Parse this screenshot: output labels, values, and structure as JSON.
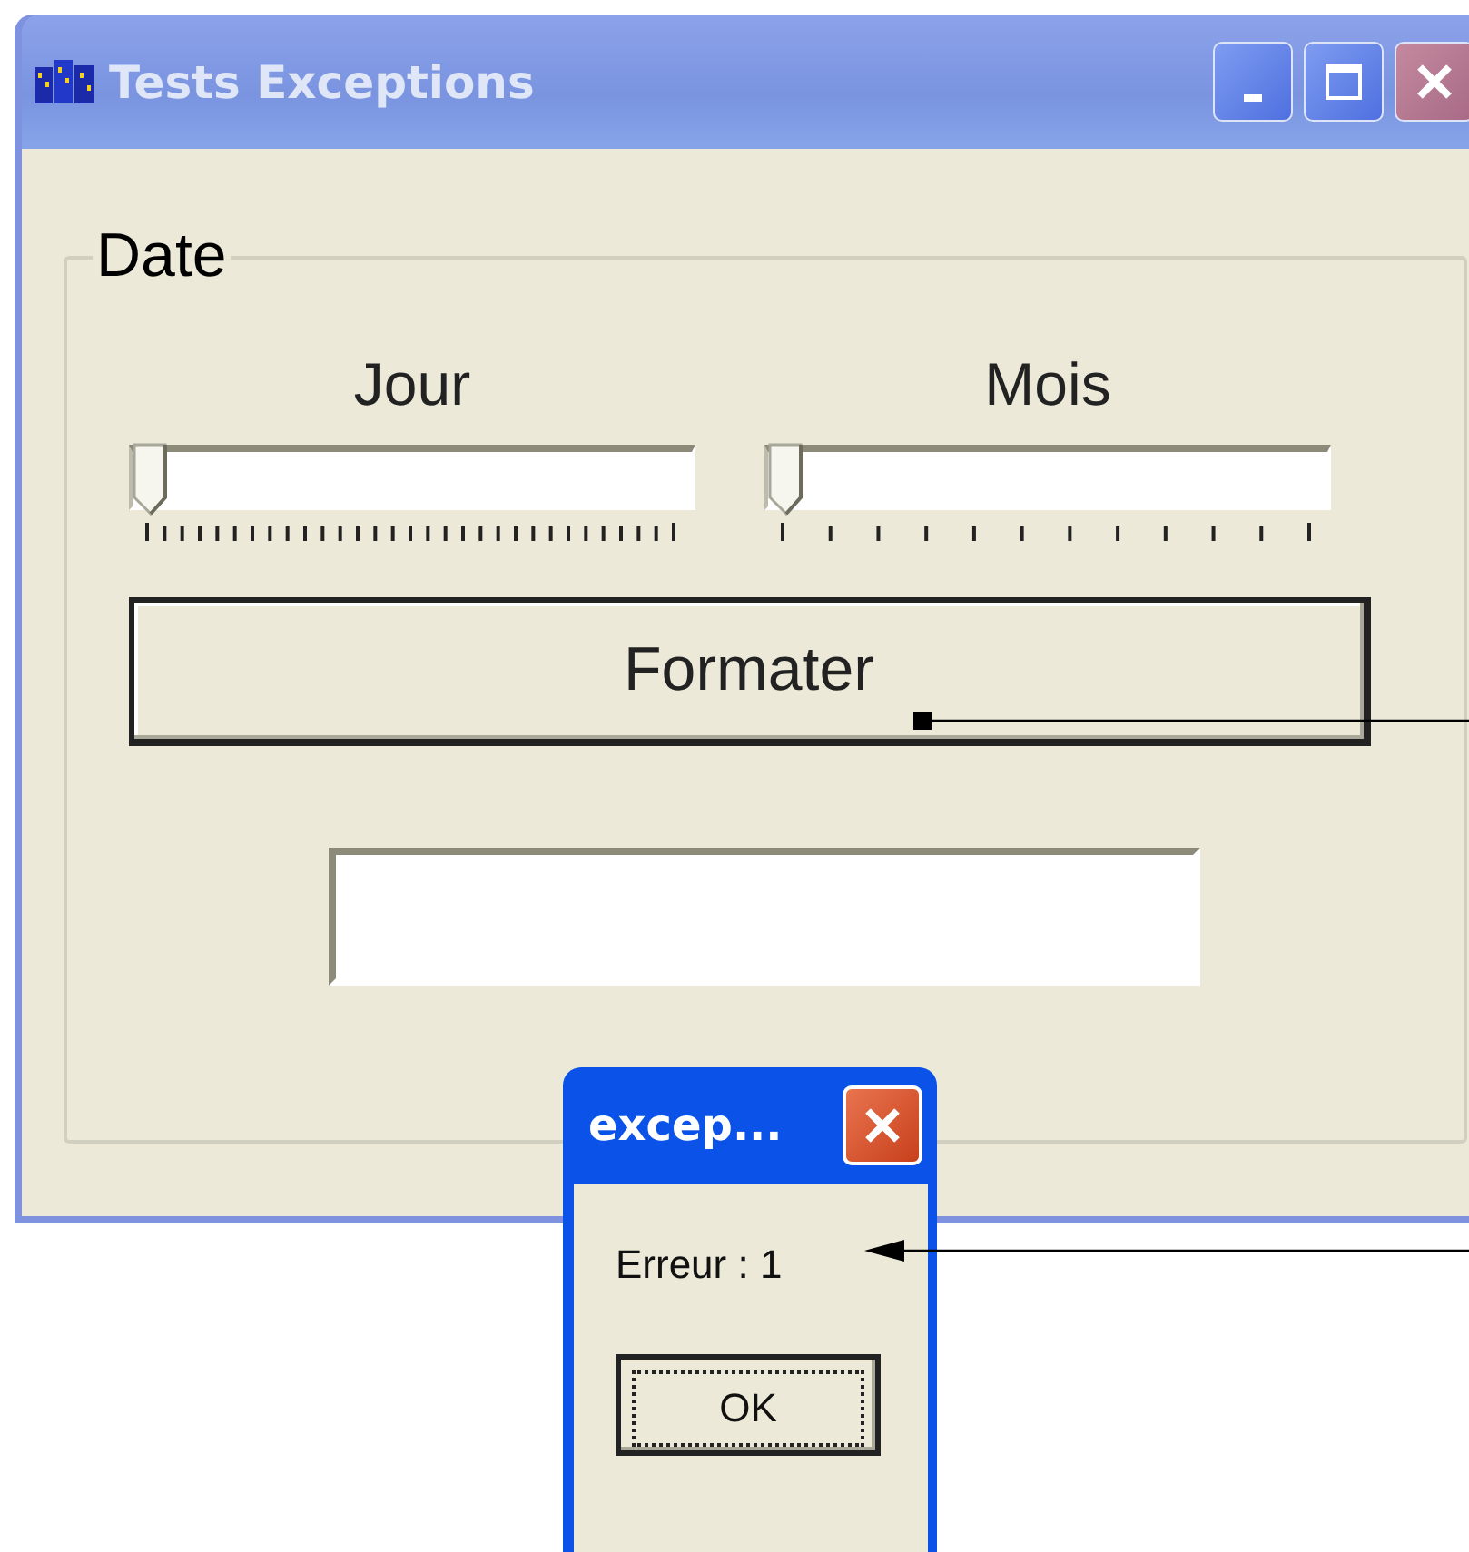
{
  "window": {
    "title": "Tests Exceptions"
  },
  "group": {
    "label": "Date"
  },
  "sliders": [
    {
      "label": "Jour",
      "kind": "days",
      "level": 0
    },
    {
      "label": "Mois",
      "kind": "months",
      "level": 0
    }
  ],
  "format_button": {
    "label": "Formater"
  },
  "dialog": {
    "title": "excep...",
    "message": "Erreur : 1",
    "button": "OK"
  }
}
